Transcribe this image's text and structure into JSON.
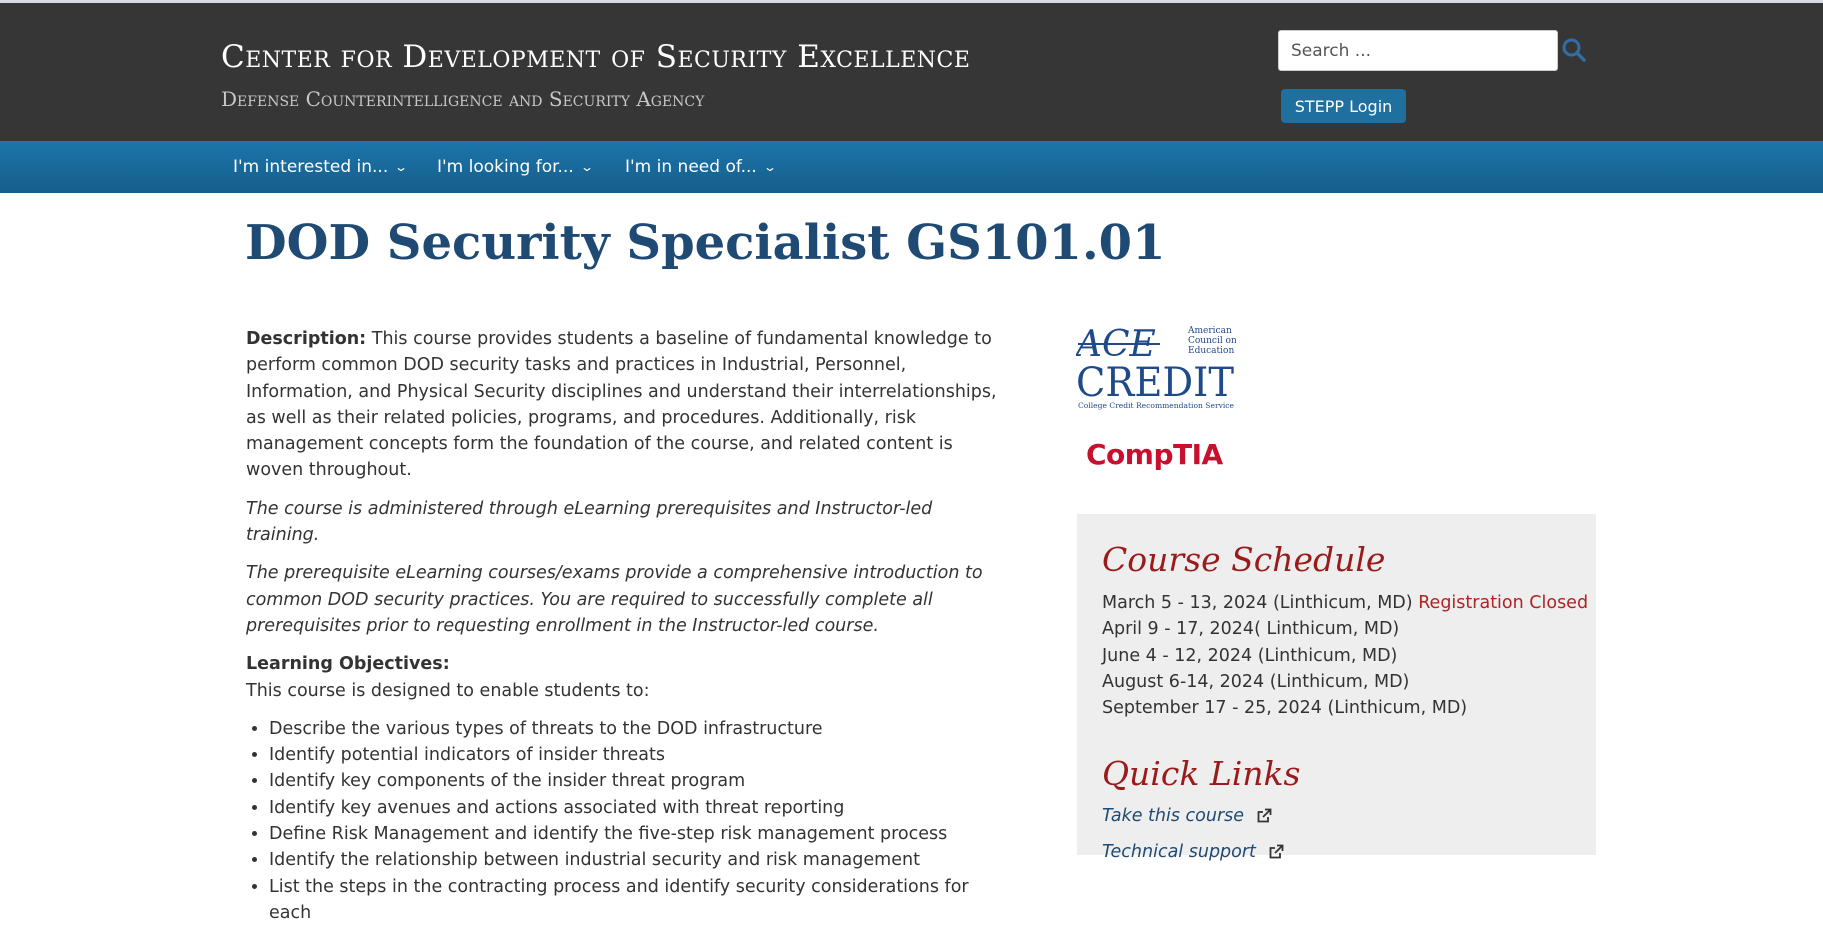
{
  "header": {
    "site_title": "Center for Development of Security Excellence",
    "site_subtitle": "Defense Counterintelligence and Security Agency",
    "search_placeholder": "Search ...",
    "stepp_login_label": "STEPP Login"
  },
  "nav": {
    "items": [
      {
        "label": "I'm interested in..."
      },
      {
        "label": "I'm looking for..."
      },
      {
        "label": "I'm in need of..."
      }
    ]
  },
  "page": {
    "title": "DOD Security Specialist GS101.01",
    "description_label": "Description:",
    "description_text": " This course provides students a baseline of fundamental knowledge to perform common DOD security tasks and practices in Industrial, Personnel, Information, and Physical Security disciplines and understand their interrelationships, as well as their related policies, programs, and procedures. Additionally, risk management concepts form the foundation of the course, and related content is woven throughout.",
    "para_administered": "The course is administered through eLearning prerequisites and Instructor-led training.",
    "para_prerequisite": "The prerequisite eLearning courses/exams provide a comprehensive introduction to common DOD security practices. You are required to successfully complete all prerequisites prior to requesting enrollment in the Instructor-led course.",
    "objectives_label": "Learning Objectives:",
    "objectives_intro": "This course is designed to enable students to:",
    "objectives": [
      "Describe the various types of threats to the DOD infrastructure",
      "Identify potential indicators of insider threats",
      "Identify key components of the insider threat program",
      "Identify key avenues and actions associated with threat reporting",
      "Define Risk Management and identify the five-step risk management process",
      "Identify the relationship between industrial security and risk management",
      "List the steps in the contracting process and identify security considerations for each"
    ]
  },
  "logos": {
    "ace_main": "ACE",
    "ace_credit": "CREDIT",
    "ace_org_line1": "American",
    "ace_org_line2": "Council on",
    "ace_org_line3": "Education",
    "ace_tagline": "College Credit Recommendation Service",
    "comptia": "CompTIA"
  },
  "sidebar": {
    "schedule_heading": "Course Schedule",
    "schedule": [
      {
        "text": "March 5 - 13, 2024 (Linthicum, MD)",
        "status": "Registration Closed"
      },
      {
        "text": "April 9 - 17, 2024( Linthicum, MD)",
        "status": ""
      },
      {
        "text": "June 4 - 12, 2024 (Linthicum, MD)",
        "status": ""
      },
      {
        "text": "August 6-14, 2024 (Linthicum, MD)",
        "status": ""
      },
      {
        "text": "September 17 - 25, 2024 (Linthicum, MD)",
        "status": ""
      }
    ],
    "quick_links_heading": "Quick Links",
    "quick_links": [
      {
        "label": "Take this course",
        "icon": "external-link-icon"
      },
      {
        "label": "Technical support",
        "icon": "external-link-icon"
      }
    ]
  },
  "colors": {
    "header_bg": "#363636",
    "nav_bg": "#1c75ab",
    "title_blue": "#1f4a73",
    "heading_red": "#9a1b1b",
    "closed_red": "#b22222",
    "comptia_red": "#c8102e"
  },
  "icons": {
    "search": "search-icon",
    "nav_chevron": "chevron-down-icon",
    "external": "external-link-icon"
  }
}
